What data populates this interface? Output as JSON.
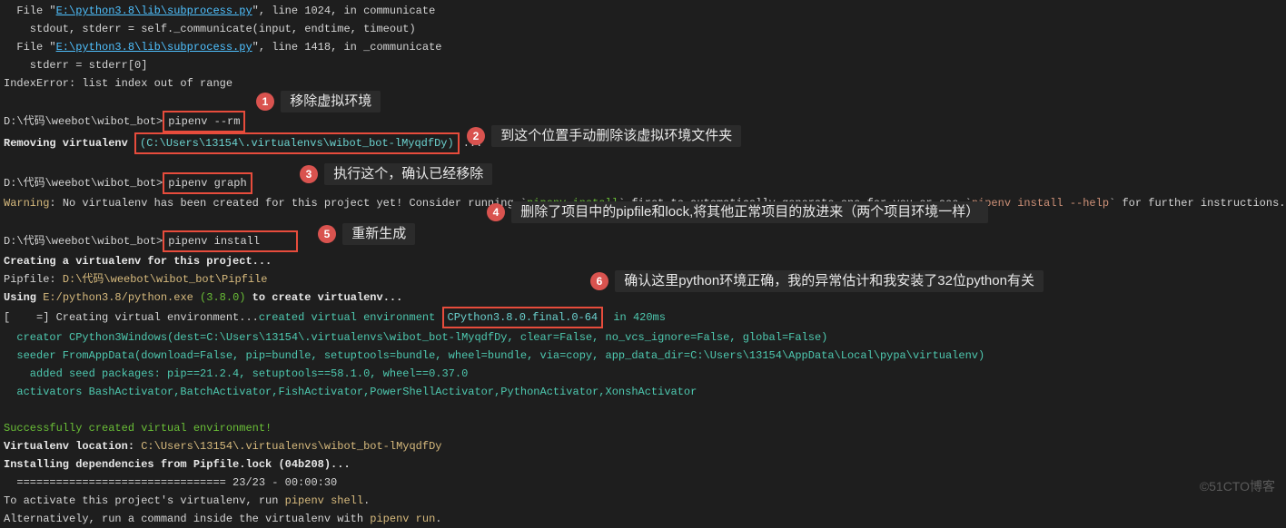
{
  "trace": {
    "file1_pre": "  File \"",
    "file1_link": "E:\\python3.8\\lib\\subprocess.py",
    "file1_post": "\", line 1024, in communicate",
    "line1": "    stdout, stderr = self._communicate(input, endtime, timeout)",
    "file2_pre": "  File \"",
    "file2_link": "E:\\python3.8\\lib\\subprocess.py",
    "file2_post": "\", line 1418, in _communicate",
    "line2": "    stderr = stderr[0]",
    "err": "IndexError: list index out of range"
  },
  "row1": {
    "prompt": "D:\\代码\\weebot\\wibot_bot>",
    "cmd": "pipenv --rm",
    "removing": "Removing virtualenv ",
    "path": "(C:\\Users\\13154\\.virtualenvs\\wibot_bot-lMyqdfDy)",
    "dots": "..."
  },
  "row2": {
    "prompt": "D:\\代码\\weebot\\wibot_bot>",
    "cmd": "pipenv graph",
    "warn_tag": "Warning",
    "warn_body": ": No virtualenv has been created for this project yet! Consider running `",
    "warn_cmd1": "pipenv install",
    "warn_body2": "` first to automatically generate one for you or see `",
    "warn_cmd2": "pipenv install --help",
    "warn_body3": "` for further instructions."
  },
  "row3": {
    "prompt": "D:\\代码\\weebot\\wibot_bot>",
    "cmd": "pipenv install",
    "creating": "Creating a virtualenv for this project...",
    "pipfile_label": "Pipfile: ",
    "pipfile_path": "D:\\代码\\weebot\\wibot_bot\\Pipfile",
    "using_pre": "Using ",
    "using_py": "E:/python3.8/python.exe",
    "using_ver": " (3.8.0)",
    "using_post": " to create virtualenv...",
    "creating_env_pre": "[    =] Creating virtual environment...",
    "created_env": "created virtual environment ",
    "cpython": "CPython3.8.0.final.0-64",
    "created_post": " in 420ms",
    "creator": "  creator CPython3Windows(dest=C:\\Users\\13154\\.virtualenvs\\wibot_bot-lMyqdfDy, clear=False, no_vcs_ignore=False, global=False)",
    "seeder": "  seeder FromAppData(download=False, pip=bundle, setuptools=bundle, wheel=bundle, via=copy, app_data_dir=C:\\Users\\13154\\AppData\\Local\\pypa\\virtualenv)",
    "added": "    added seed packages: pip==21.2.4, setuptools==58.1.0, wheel==0.37.0",
    "activators": "  activators BashActivator,BatchActivator,FishActivator,PowerShellActivator,PythonActivator,XonshActivator",
    "success": "Successfully created virtual environment!",
    "loc_label": "Virtualenv location: ",
    "loc_path": "C:\\Users\\13154\\.virtualenvs\\wibot_bot-lMyqdfDy",
    "installing": "Installing dependencies from Pipfile.lock (04b208)...",
    "progress": "  ================================ 23/23 - 00:00:30",
    "activate_pre": "To activate this project's virtualenv, run ",
    "activate_cmd": "pipenv shell",
    "activate_post": ".",
    "alt_pre": "Alternatively, run a command inside the virtualenv with ",
    "alt_cmd": "pipenv run",
    "alt_post": "."
  },
  "annotations": {
    "a1": {
      "num": "1",
      "label": "移除虚拟环境"
    },
    "a2": {
      "num": "2",
      "label": "到这个位置手动删除该虚拟环境文件夹"
    },
    "a3": {
      "num": "3",
      "label": "执行这个，确认已经移除"
    },
    "a4": {
      "num": "4",
      "label": "删除了项目中的pipfile和lock,将其他正常项目的放进来（两个项目环境一样）"
    },
    "a5": {
      "num": "5",
      "label": "重新生成"
    },
    "a6": {
      "num": "6",
      "label": "确认这里python环境正确，我的异常估计和我安装了32位python有关"
    }
  },
  "watermark": "©51CTO博客"
}
